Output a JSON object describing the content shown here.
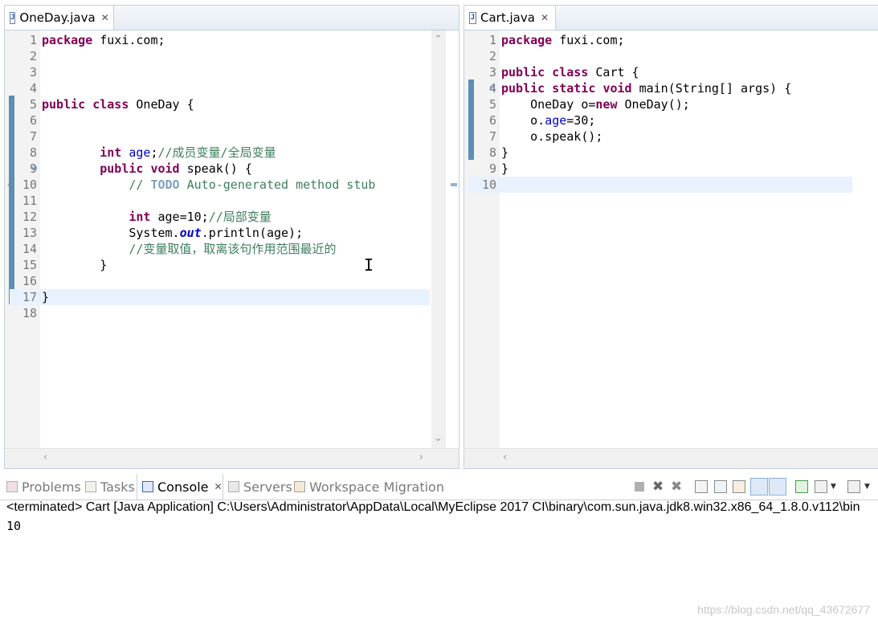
{
  "left_editor": {
    "tab_title": "OneDay.java",
    "lines": [
      {
        "n": "1",
        "tokens": [
          {
            "t": "package",
            "c": "kw"
          },
          {
            "t": " fuxi.com;",
            "c": ""
          }
        ]
      },
      {
        "n": "2",
        "tokens": []
      },
      {
        "n": "3",
        "tokens": []
      },
      {
        "n": "4",
        "tokens": []
      },
      {
        "n": "5",
        "tokens": [
          {
            "t": "public",
            "c": "kw"
          },
          {
            "t": " ",
            "c": ""
          },
          {
            "t": "class",
            "c": "kw"
          },
          {
            "t": " OneDay {",
            "c": ""
          }
        ]
      },
      {
        "n": "6",
        "tokens": []
      },
      {
        "n": "7",
        "tokens": []
      },
      {
        "n": "8",
        "tokens": [
          {
            "t": "        ",
            "c": ""
          },
          {
            "t": "int",
            "c": "kw"
          },
          {
            "t": " ",
            "c": ""
          },
          {
            "t": "age",
            "c": "fld"
          },
          {
            "t": ";",
            "c": ""
          },
          {
            "t": "//成员变量/全局变量",
            "c": "cmt"
          }
        ]
      },
      {
        "n": "9",
        "tokens": [
          {
            "t": "        ",
            "c": ""
          },
          {
            "t": "public",
            "c": "kw"
          },
          {
            "t": " ",
            "c": ""
          },
          {
            "t": "void",
            "c": "kw"
          },
          {
            "t": " speak() {",
            "c": ""
          }
        ]
      },
      {
        "n": "10",
        "tokens": [
          {
            "t": "            ",
            "c": ""
          },
          {
            "t": "// ",
            "c": "cmt"
          },
          {
            "t": "TODO",
            "c": "todo"
          },
          {
            "t": " Auto-generated method stub",
            "c": "cmt"
          }
        ]
      },
      {
        "n": "11",
        "tokens": []
      },
      {
        "n": "12",
        "tokens": [
          {
            "t": "            ",
            "c": ""
          },
          {
            "t": "int",
            "c": "kw"
          },
          {
            "t": " age=10;",
            "c": ""
          },
          {
            "t": "//局部变量",
            "c": "cmt"
          }
        ]
      },
      {
        "n": "13",
        "tokens": [
          {
            "t": "            System.",
            "c": ""
          },
          {
            "t": "out",
            "c": "sfld"
          },
          {
            "t": ".println(age);",
            "c": ""
          }
        ]
      },
      {
        "n": "14",
        "tokens": [
          {
            "t": "            ",
            "c": ""
          },
          {
            "t": "//变量取值，取离该句作用范围最近的",
            "c": "cmt"
          }
        ]
      },
      {
        "n": "15",
        "tokens": [
          {
            "t": "        }",
            "c": ""
          }
        ]
      },
      {
        "n": "16",
        "tokens": []
      },
      {
        "n": "17",
        "tokens": [
          {
            "t": "}",
            "c": ""
          }
        ]
      },
      {
        "n": "18",
        "tokens": []
      }
    ]
  },
  "right_editor": {
    "tab_title": "Cart.java",
    "lines": [
      {
        "n": "1",
        "tokens": [
          {
            "t": "package",
            "c": "kw"
          },
          {
            "t": " fuxi.com;",
            "c": ""
          }
        ]
      },
      {
        "n": "2",
        "tokens": []
      },
      {
        "n": "3",
        "tokens": [
          {
            "t": "public",
            "c": "kw"
          },
          {
            "t": " ",
            "c": ""
          },
          {
            "t": "class",
            "c": "kw"
          },
          {
            "t": " Cart {",
            "c": ""
          }
        ]
      },
      {
        "n": "4",
        "tokens": [
          {
            "t": "public",
            "c": "kw"
          },
          {
            "t": " ",
            "c": ""
          },
          {
            "t": "static",
            "c": "kw"
          },
          {
            "t": " ",
            "c": ""
          },
          {
            "t": "void",
            "c": "kw"
          },
          {
            "t": " main(String[] args) {",
            "c": ""
          }
        ]
      },
      {
        "n": "5",
        "tokens": [
          {
            "t": "    OneDay o=",
            "c": ""
          },
          {
            "t": "new",
            "c": "kw"
          },
          {
            "t": " OneDay();",
            "c": ""
          }
        ]
      },
      {
        "n": "6",
        "tokens": [
          {
            "t": "    o.",
            "c": ""
          },
          {
            "t": "age",
            "c": "fld"
          },
          {
            "t": "=30;",
            "c": ""
          }
        ]
      },
      {
        "n": "7",
        "tokens": [
          {
            "t": "    o.speak();",
            "c": ""
          }
        ]
      },
      {
        "n": "8",
        "tokens": [
          {
            "t": "}",
            "c": ""
          }
        ]
      },
      {
        "n": "9",
        "tokens": [
          {
            "t": "}",
            "c": ""
          }
        ]
      },
      {
        "n": "10",
        "tokens": []
      }
    ]
  },
  "console": {
    "tabs": [
      {
        "label": "Problems",
        "icon": "problems-icon"
      },
      {
        "label": "Tasks",
        "icon": "tasks-icon"
      },
      {
        "label": "Console",
        "icon": "console-icon",
        "active": true
      },
      {
        "label": "Servers",
        "icon": "servers-icon"
      },
      {
        "label": "Workspace Migration",
        "icon": "workspace-migration-icon"
      }
    ],
    "status_line": "<terminated> Cart [Java Application] C:\\Users\\Administrator\\AppData\\Local\\MyEclipse 2017 CI\\binary\\com.sun.java.jdk8.win32.x86_64_1.8.0.v112\\bin",
    "output": "10",
    "toolbar_icons": [
      "stop-icon",
      "remove-launch-icon",
      "remove-all-icon",
      "scroll-lock-icon",
      "word-wrap-icon",
      "pin-console-icon",
      "show-on-stdout-icon",
      "show-on-stderr-icon",
      "open-console-icon",
      "display-console-icon",
      "new-console-icon"
    ]
  },
  "watermark": "https://blog.csdn.net/qq_43672677",
  "colors": {
    "keyword": "#7f0055",
    "field": "#0000c0",
    "comment": "#3f7f5f",
    "todo": "#7f9fbf",
    "current_line": "#e8f2fe",
    "change_bar": "#5c8fb5"
  }
}
